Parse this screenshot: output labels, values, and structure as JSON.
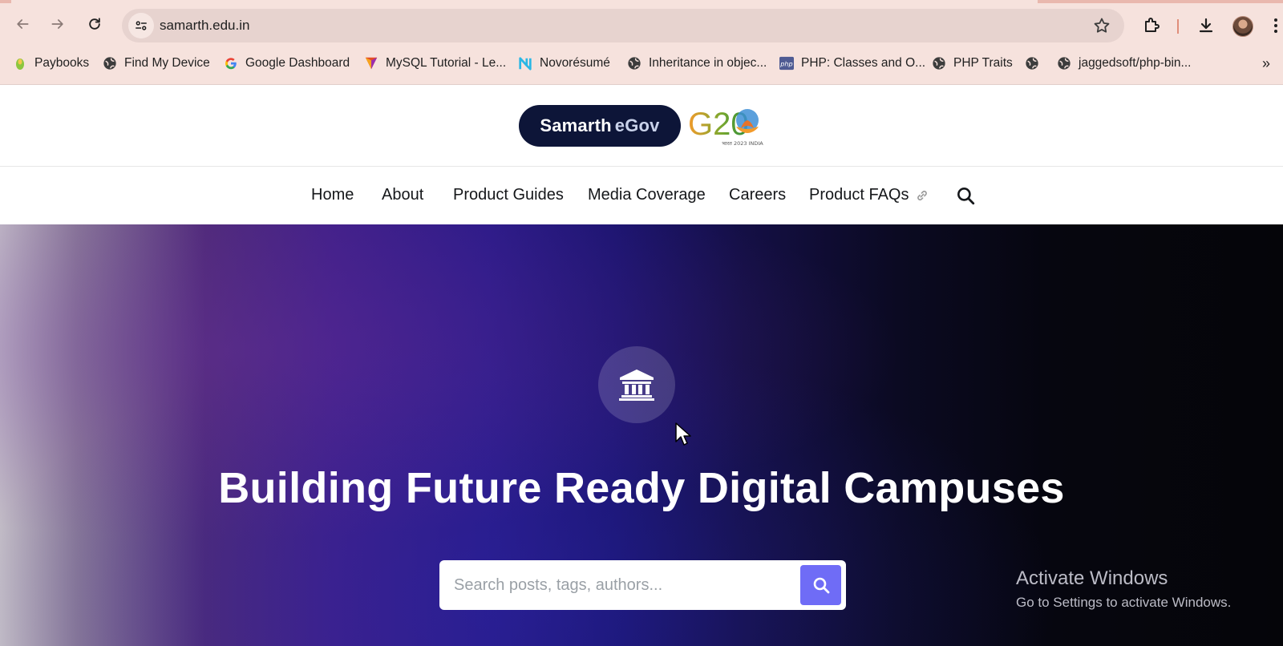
{
  "browser": {
    "url": "samarth.edu.in",
    "bookmarks": [
      {
        "label": "Paybooks",
        "icon": "paybooks-icon"
      },
      {
        "label": "Find My Device",
        "icon": "globe-icon"
      },
      {
        "label": "Google Dashboard",
        "icon": "google-icon"
      },
      {
        "label": "MySQL Tutorial - Le...",
        "icon": "mysql-tutorial-icon"
      },
      {
        "label": "Novorésumé",
        "icon": "novoresume-icon"
      },
      {
        "label": "Inheritance in objec...",
        "icon": "globe-icon"
      },
      {
        "label": "PHP: Classes and O...",
        "icon": "php-icon"
      },
      {
        "label": "PHP Traits",
        "icon": "globe-icon"
      },
      {
        "label": "",
        "icon": "globe-icon"
      },
      {
        "label": "jaggedsoft/php-bin...",
        "icon": "globe-icon"
      }
    ],
    "overflow_label": "»"
  },
  "site": {
    "logo": {
      "part1": "Samarth",
      "part2": "eGov"
    },
    "g20_logo": {
      "text": "G20",
      "subtext": "भारत 2023 INDIA"
    },
    "nav": [
      {
        "label": "Home"
      },
      {
        "label": "About"
      },
      {
        "label": "Product Guides"
      },
      {
        "label": "Media Coverage"
      },
      {
        "label": "Careers"
      },
      {
        "label": "Product FAQs"
      }
    ]
  },
  "hero": {
    "icon": "institution-icon",
    "title": "Building Future Ready Digital Campuses",
    "search_placeholder": "Search posts, tags, authors..."
  },
  "os_overlay": {
    "line1": "Activate Windows",
    "line2": "Go to Settings to activate Windows."
  },
  "colors": {
    "chrome_bg": "#f6e2dd",
    "logo_bg": "#0d1538",
    "search_button": "#6f6cf6"
  }
}
